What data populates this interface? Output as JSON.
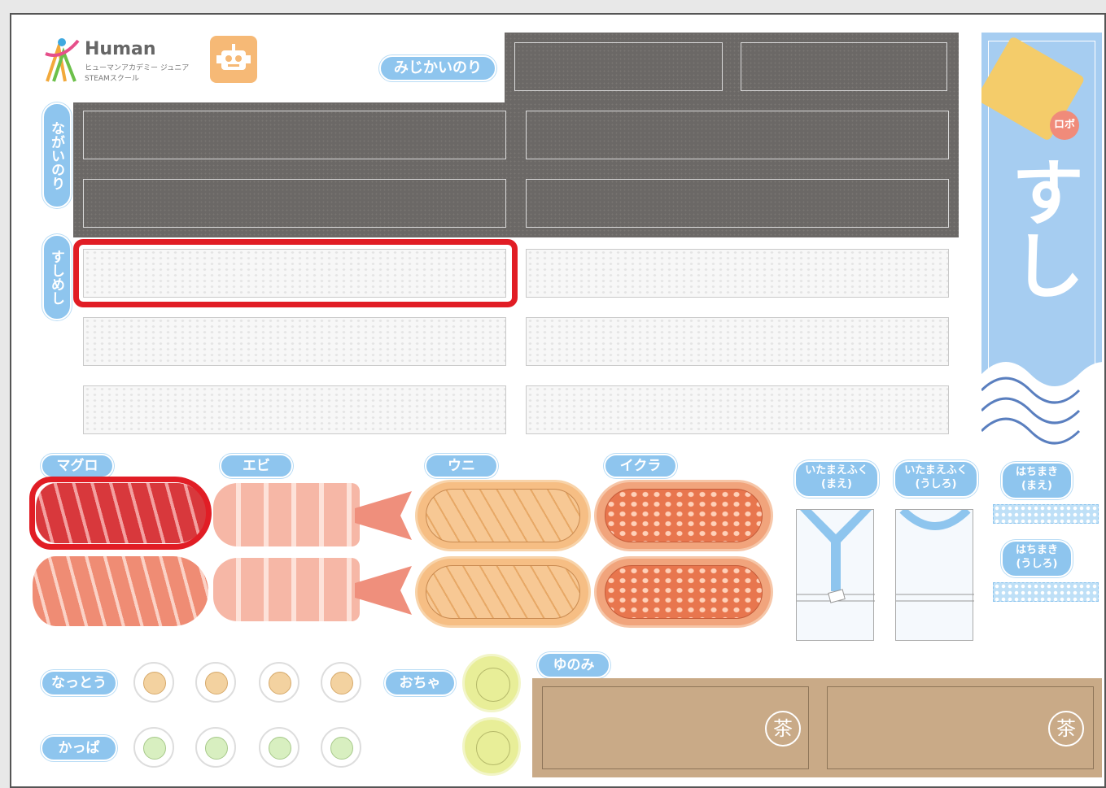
{
  "logo": {
    "brand": "Human",
    "sub1": "ヒューマンアカデミー ジュニア",
    "sub2": "STEAMスクール"
  },
  "labels": {
    "mijikai_nori": "みじかいのり",
    "nagai_nori": "ながいのり",
    "sushimeshi": "すしめし",
    "maguro": "マグロ",
    "ebi": "エビ",
    "uni": "ウニ",
    "ikura": "イクラ",
    "itamaefuku_mae": "いたまえふく\n(まえ)",
    "itamaefuku_ushiro": "いたまえふく\n(うしろ)",
    "hachimaki_mae": "はちまき\n(まえ)",
    "hachimaki_ushiro": "はちまき\n(うしろ)",
    "natto": "なっとう",
    "kappa": "かっぱ",
    "ocha": "おちゃ",
    "yunomi": "ゆのみ"
  },
  "banner": {
    "title": "すし",
    "robo": "ロボ"
  },
  "yunomi_mark": "茶",
  "colors": {
    "label_blue": "#8ec5ee",
    "highlight_red": "#e11d25",
    "nori": "#6b6866"
  }
}
